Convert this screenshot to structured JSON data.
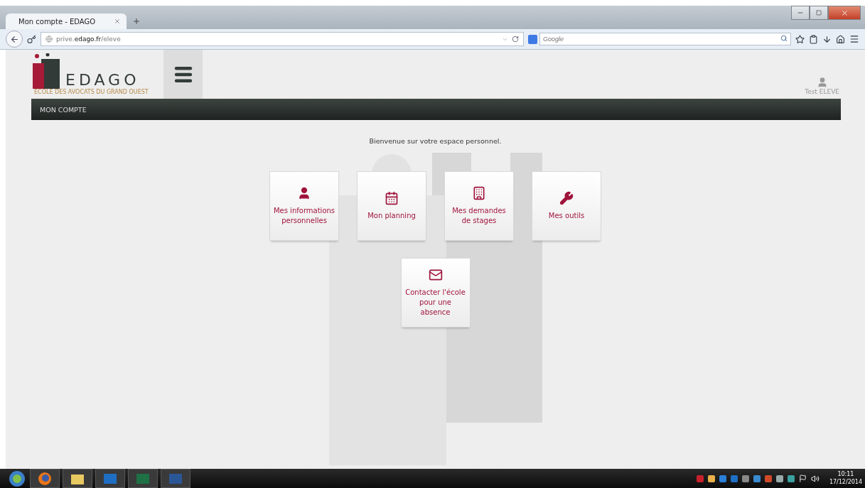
{
  "browser": {
    "tab_title": "Mon compte - EDAGO",
    "url": "prive.**edago.fr**/eleve",
    "search": {
      "placeholder": "Google"
    }
  },
  "header": {
    "logo": {
      "name": "EDAGO",
      "tagline": "ECOLE DES AVOCATS DU GRAND OUEST"
    },
    "user": "Test ELEVE"
  },
  "nav": {
    "items": [
      {
        "label": "MON COMPTE"
      }
    ]
  },
  "welcome": "Bienvenue sur votre espace personnel.",
  "tiles": [
    {
      "kind": "user",
      "label": "Mes informations personnelles"
    },
    {
      "kind": "calendar",
      "label": "Mon planning"
    },
    {
      "kind": "building",
      "label": "Mes demandes de stages"
    },
    {
      "kind": "wrench",
      "label": "Mes outils"
    },
    {
      "kind": "mail",
      "label": "Contacter l'école pour une absence"
    }
  ],
  "taskbar": {
    "time": "10:11",
    "date": "17/12/2014"
  }
}
